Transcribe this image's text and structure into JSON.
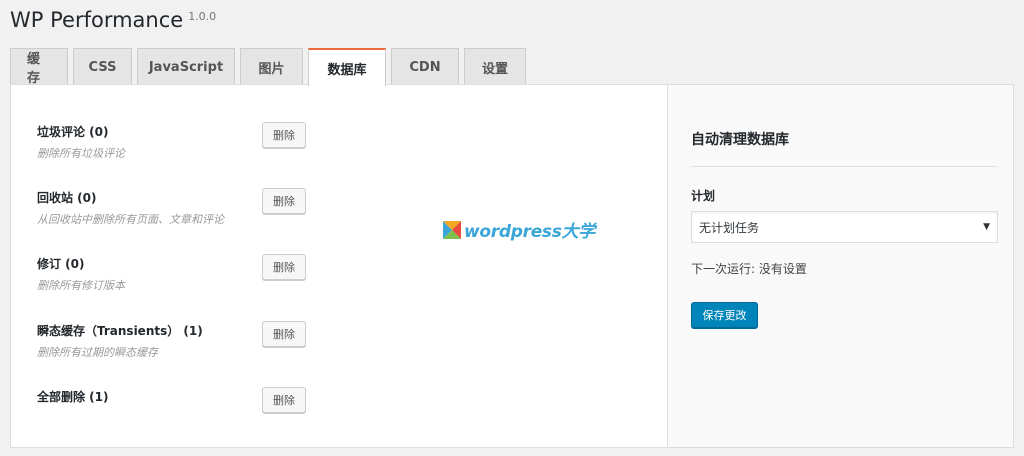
{
  "header": {
    "title": "WP Performance",
    "version": "1.0.0"
  },
  "tabs": [
    {
      "label": "缓存",
      "active": false
    },
    {
      "label": "CSS",
      "active": false
    },
    {
      "label": "JavaScript",
      "active": false
    },
    {
      "label": "图片",
      "active": false
    },
    {
      "label": "数据库",
      "active": true
    },
    {
      "label": "CDN",
      "active": false
    },
    {
      "label": "设置",
      "active": false
    }
  ],
  "main": {
    "rows": [
      {
        "label": "垃圾评论 (0)",
        "desc": "删除所有垃圾评论",
        "button": "删除"
      },
      {
        "label": "回收站 (0)",
        "desc": "从回收站中删除所有页面、文章和评论",
        "button": "删除"
      },
      {
        "label": "修订 (0)",
        "desc": "删除所有修订版本",
        "button": "删除"
      },
      {
        "label": "瞬态缓存（Transients） (1)",
        "desc": "删除所有过期的瞬态缓存",
        "button": "删除"
      },
      {
        "label": "全部删除 (1)",
        "desc": "",
        "button": "删除"
      }
    ],
    "watermark": "wordpress大学"
  },
  "side": {
    "title": "自动清理数据库",
    "schedule_label": "计划",
    "schedule_value": "无计划任务",
    "next_run": "下一次运行: 没有设置",
    "save_label": "保存更改"
  },
  "colors": {
    "accent_tab": "#ec6a3c",
    "primary_button": "#0085ba",
    "watermark": "#3aa6d8"
  }
}
